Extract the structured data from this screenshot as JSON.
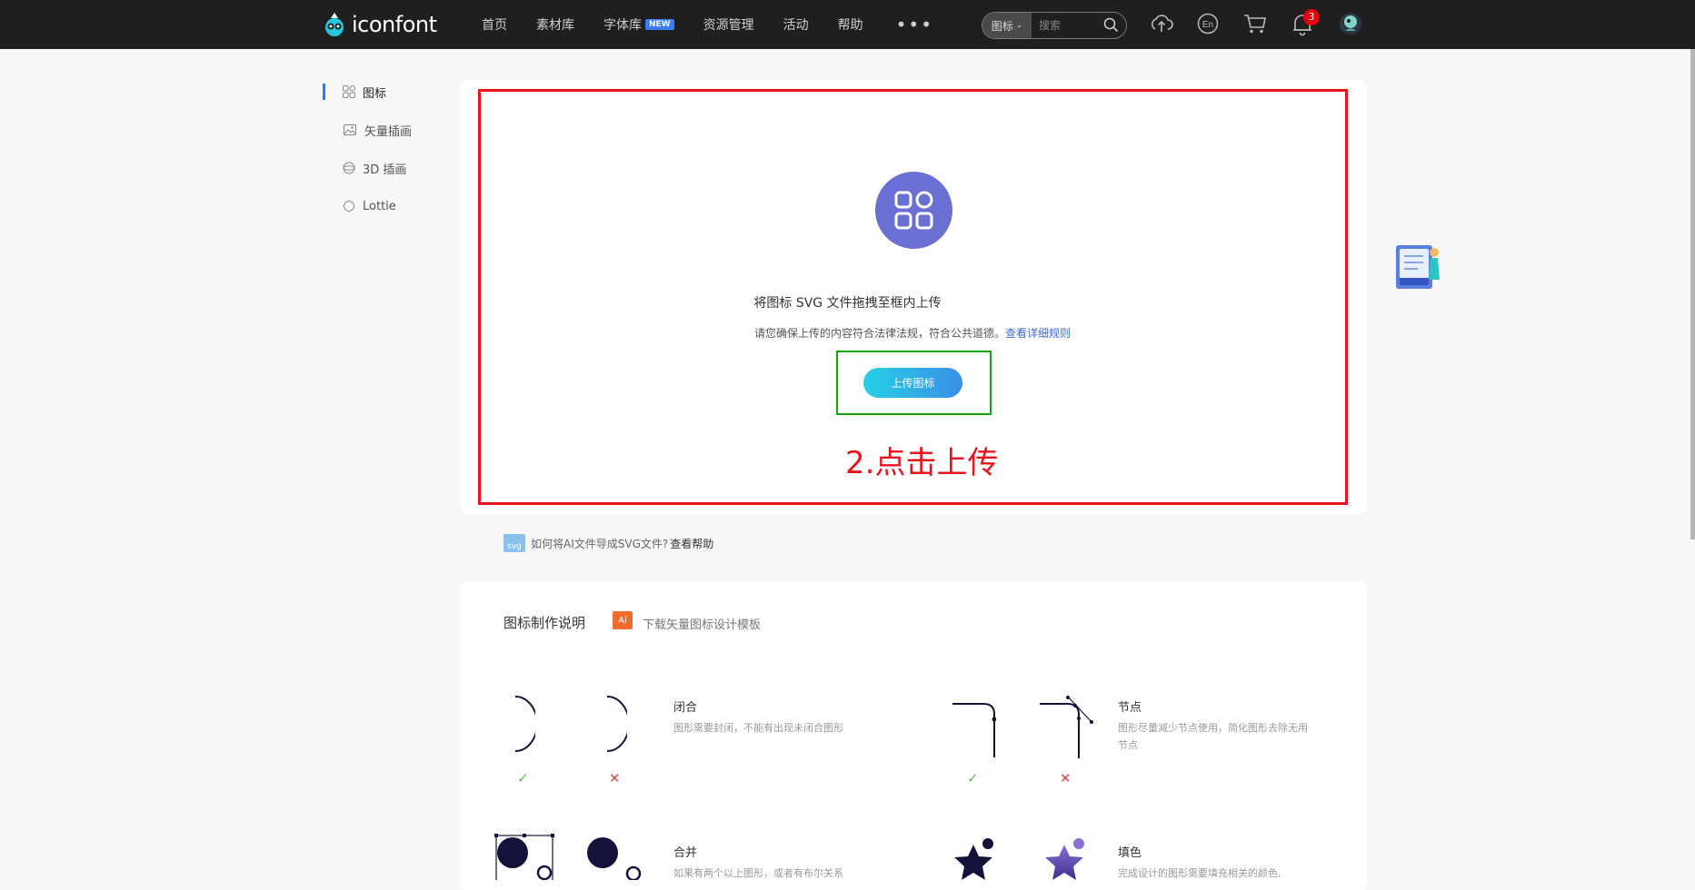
{
  "header": {
    "logo_text": "iconfont",
    "nav": [
      {
        "label": "首页"
      },
      {
        "label": "素材库"
      },
      {
        "label": "字体库",
        "badge": "NEW"
      },
      {
        "label": "资源管理"
      },
      {
        "label": "活动"
      },
      {
        "label": "帮助"
      }
    ],
    "more_label": "•••",
    "search": {
      "type_label": "图标",
      "placeholder": "搜索"
    },
    "notification_count": "3",
    "icons": [
      "upload-cloud-icon",
      "language-en-icon",
      "cart-icon",
      "bell-icon",
      "avatar"
    ]
  },
  "sidebar": {
    "items": [
      {
        "label": "图标",
        "icon": "grid-icon",
        "active": true
      },
      {
        "label": "矢量插画",
        "icon": "image-icon"
      },
      {
        "label": "3D 插画",
        "icon": "sphere-icon"
      },
      {
        "label": "Lottie",
        "icon": "lottie-icon"
      }
    ]
  },
  "upload": {
    "title": "将图标 SVG 文件拖拽至框内上传",
    "note": "请您确保上传的内容符合法律法规，符合公共道德。",
    "note_link": "查看详细规则",
    "button_label": "上传图标",
    "annotation": "2.点击上传"
  },
  "help": {
    "badge": "svg",
    "text": "如何将AI文件导成SVG文件?",
    "link": "查看帮助"
  },
  "guide": {
    "title": "图标制作说明",
    "ai_badge": "Ai",
    "template_link": "下载矢量图标设计模板",
    "rules": [
      {
        "title": "闭合",
        "desc": "图形需要封闭，不能有出现未闭合图形"
      },
      {
        "title": "节点",
        "desc": "图形尽量减少节点使用，简化图形去除无用节点"
      },
      {
        "title": "合并",
        "desc": "如果有两个以上图形，或者有布尔关系"
      },
      {
        "title": "填色",
        "desc": "完成设计的图形需要填充相关的颜色,"
      }
    ],
    "ok_mark": "✓",
    "bad_mark": "✕"
  },
  "colors": {
    "topbar": "#1f1f1f",
    "accent_circle": "#6a6fd4",
    "annotation_red": "#e8131d",
    "annotation_green": "#14a614"
  }
}
